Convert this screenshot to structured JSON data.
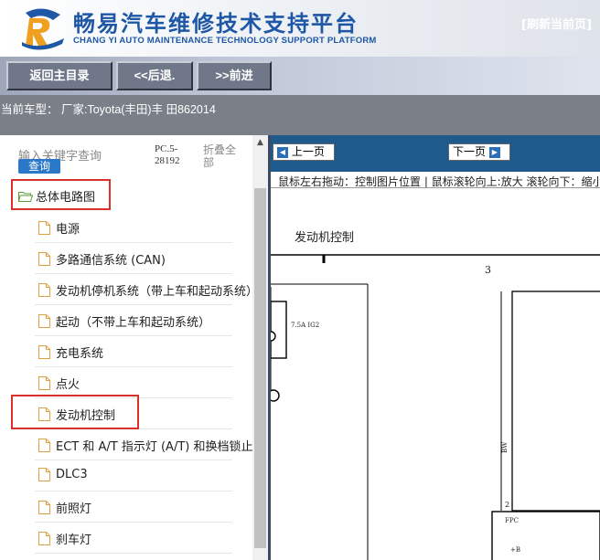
{
  "header": {
    "brand_cn": "畅易汽车维修技术支持平台",
    "brand_en": "CHANG YI AUTO MAINTENANCE TECHNOLOGY SUPPORT PLATFORM"
  },
  "toolbar": {
    "home_label": "返回主目录",
    "back_label": "<<后退.",
    "forward_label": ">>前进"
  },
  "model_bar": {
    "text": "当前车型： 厂家:Toyota(丰田)丰 田862014"
  },
  "sidebar": {
    "search_placeholder": "输入关键字查询",
    "search_button": "查询",
    "pc_code": "PC.5-28192",
    "collapse_all": "折叠全部",
    "root_label": "总体电路图",
    "items": [
      {
        "label": "电源"
      },
      {
        "label": "多路通信系统 (CAN)"
      },
      {
        "label": "发动机停机系统（带上车和起动系统）"
      },
      {
        "label": "起动（不带上车和起动系统）"
      },
      {
        "label": "充电系统"
      },
      {
        "label": "点火"
      },
      {
        "label": "发动机控制"
      },
      {
        "label": "ECT 和 A/T 指示灯 (A/T) 和换档锁止"
      },
      {
        "label": "DLC3"
      },
      {
        "label": "前照灯"
      },
      {
        "label": "刹车灯"
      }
    ]
  },
  "viewer": {
    "prev_label": "上一页",
    "next_label": "下一页",
    "refresh_label": "[刷新当前页]",
    "hint": "鼠标左右拖动：控制图片位置 | 鼠标滚轮向上:放大   滚轮向下：缩小",
    "diagram_title": "发动机控制",
    "diagram_num": "3",
    "fuse_label": "7.5A IG2",
    "wire_label": "BW",
    "pin_label": "2",
    "conn_label": "FPC",
    "pin2_label": "+B"
  },
  "colors": {
    "brand_blue": "#1d57a6",
    "viewer_header": "#1f5a8c",
    "highlight_red": "#d9302c"
  }
}
